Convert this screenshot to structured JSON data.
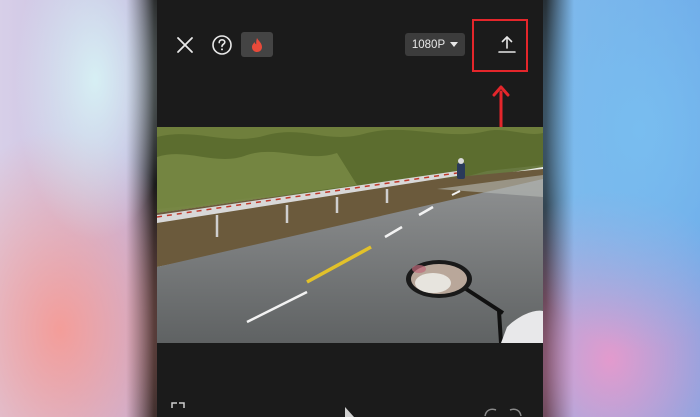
{
  "toolbar": {
    "close_icon": "close-icon",
    "help_icon": "help-icon",
    "fire_icon": "flame-icon",
    "resolution_label": "1080P",
    "export_icon": "export-upload-icon"
  },
  "annotation": {
    "highlight_color": "#e4262b"
  },
  "colors": {
    "app_background": "#1b1b1b",
    "button_background": "#3c3c3c",
    "icon_color": "#e8e8e8",
    "flame_color": "#e84a3a"
  },
  "preview": {
    "description_icon": "video-frame"
  },
  "bottom_controls": {
    "fullscreen_icon": "fullscreen-icon",
    "play_icon": "play-icon",
    "undo_icon": "undo-icon",
    "redo_icon": "redo-icon"
  }
}
